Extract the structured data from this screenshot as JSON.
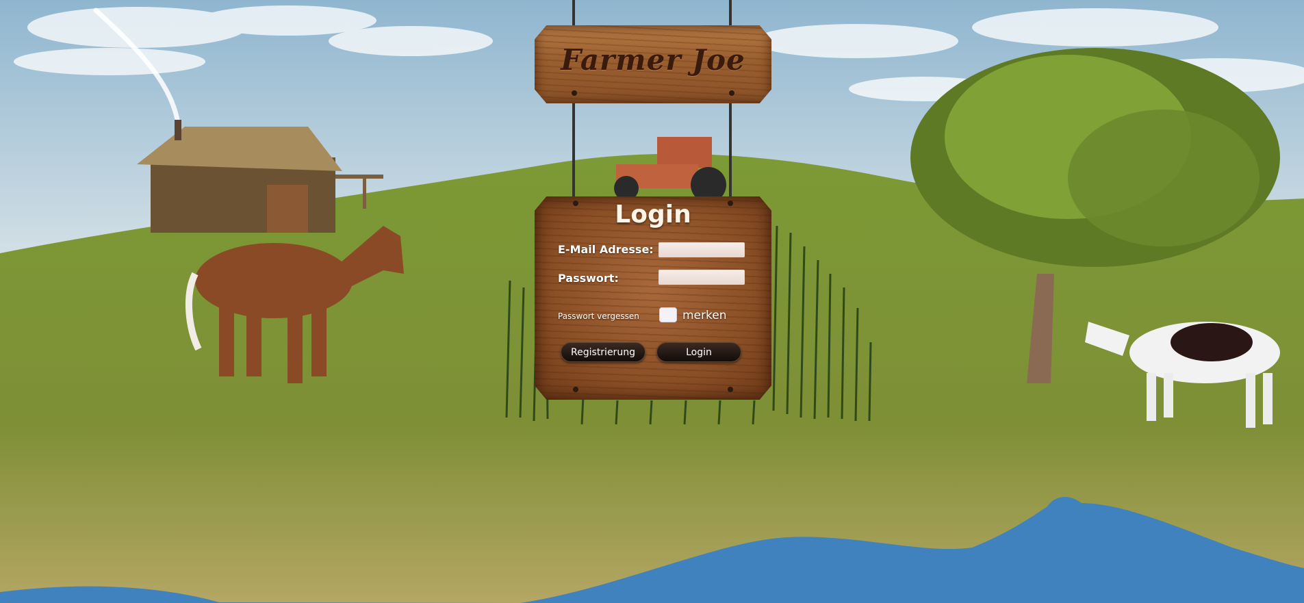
{
  "logo": {
    "text": "Farmer Joe"
  },
  "login": {
    "title": "Login",
    "email_label": "E-Mail Adresse:",
    "email_value": "",
    "password_label": "Passwort:",
    "password_value": "",
    "forgot_link": "Passwort vergessen",
    "remember_checked": false,
    "remember_label": "merken",
    "register_button": "Registrierung",
    "login_button": "Login"
  },
  "colors": {
    "sky": "#cfe0ea",
    "grass": "#6f8a30",
    "water": "#3f82be",
    "wood": "#9a5f2f",
    "button": "#1a120e"
  }
}
